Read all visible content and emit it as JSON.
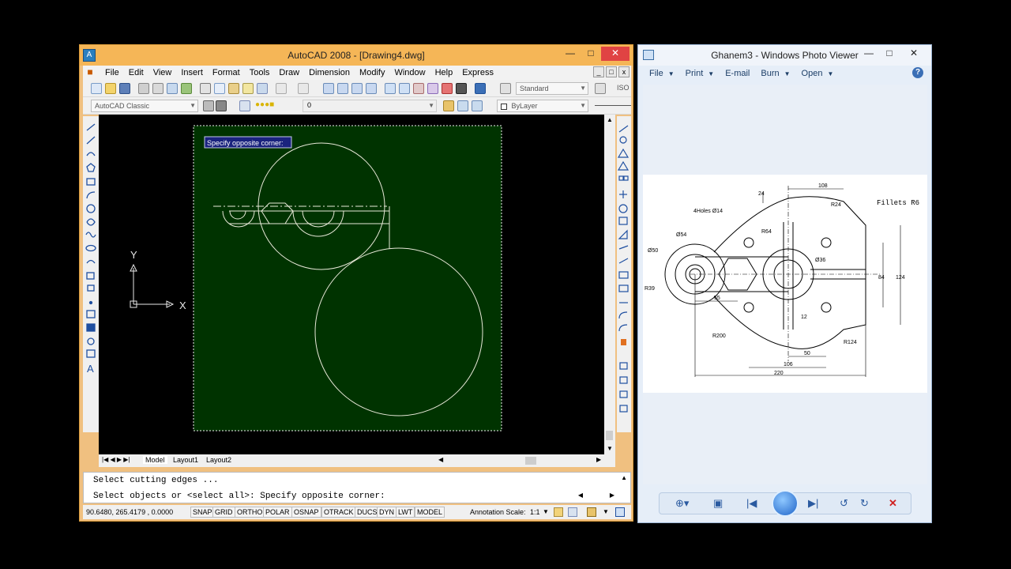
{
  "acad": {
    "title": "AutoCAD 2008 - [Drawing4.dwg]",
    "window_buttons": {
      "minimize": "—",
      "maximize": "□",
      "close": "✕"
    },
    "menu": [
      "File",
      "Edit",
      "View",
      "Insert",
      "Format",
      "Tools",
      "Draw",
      "Dimension",
      "Modify",
      "Window",
      "Help",
      "Express"
    ],
    "text_style": "Standard",
    "dim_style_fragment": "ISO",
    "workspace": "AutoCAD Classic",
    "layer_value": "0",
    "color_value": "ByLayer",
    "tooltip": "Specify opposite corner:",
    "axis_x": "X",
    "axis_y": "Y",
    "tabs": {
      "model": "Model",
      "layout1": "Layout1",
      "layout2": "Layout2"
    },
    "command_lines": [
      "Select cutting edges ...",
      "Select objects or <select all>: Specify opposite corner:"
    ],
    "coords": "90.6480, 265.4179 , 0.0000",
    "status_buttons": [
      "SNAP",
      "GRID",
      "ORTHO",
      "POLAR",
      "OSNAP",
      "OTRACK",
      "DUCS",
      "DYN",
      "LWT",
      "MODEL"
    ],
    "annotation_scale_label": "Annotation Scale:",
    "annotation_scale_value": "1:1",
    "colors": {
      "drawing_bg": "#003300",
      "geometry": "#e8e8d8"
    }
  },
  "photoviewer": {
    "title": "Ghanem3 - Windows Photo Viewer",
    "menu": [
      "File",
      "Print",
      "E-mail",
      "Burn",
      "Open"
    ],
    "help_icon": "?",
    "image_annotations": {
      "fillets": "Fillets R6",
      "holes": "4Holes Ø14",
      "d108": "108",
      "d24": "24",
      "r24": "R24",
      "r64": "R64",
      "d54": "Ø54",
      "d50": "Ø50",
      "r39": "R39",
      "d55": "55",
      "d36": "Ø36",
      "d84": "84",
      "d124": "124",
      "d12": "12",
      "r200": "R200",
      "r124": "R124",
      "d50b": "50",
      "d106": "106",
      "d220": "220"
    },
    "controls": [
      "zoom-icon",
      "actual-size-icon",
      "previous-icon",
      "slideshow-icon",
      "next-icon",
      "rotate-left-icon",
      "rotate-right-icon",
      "delete-icon"
    ]
  }
}
